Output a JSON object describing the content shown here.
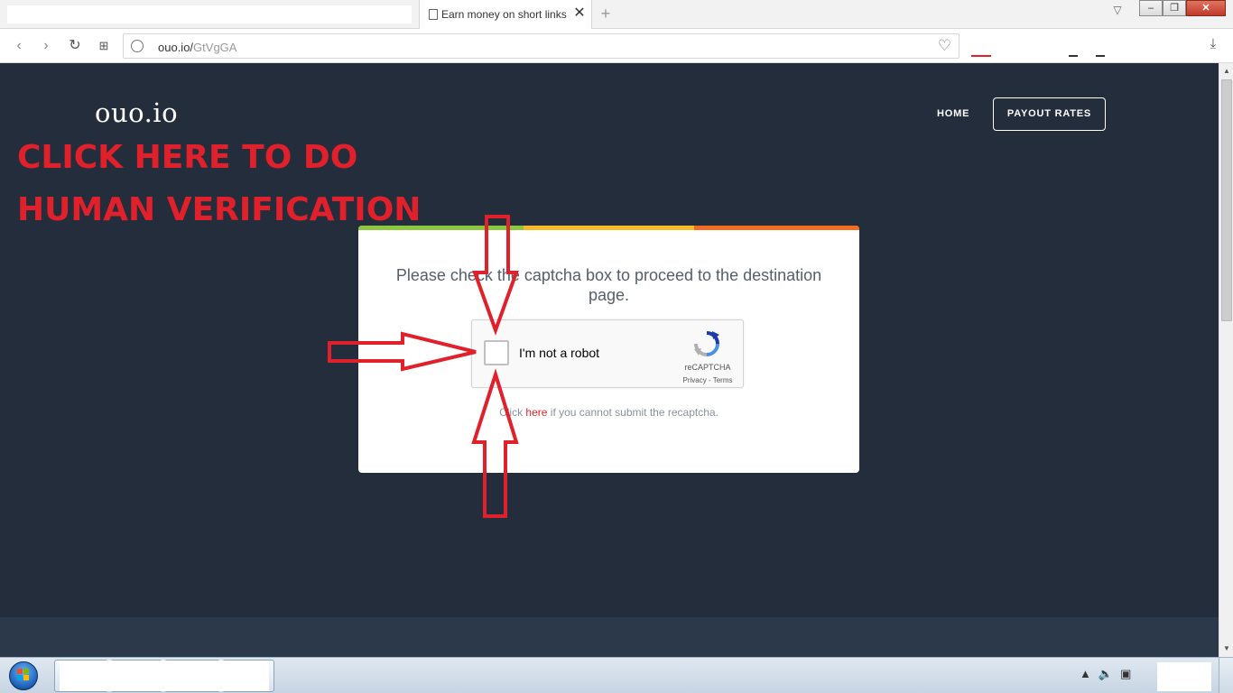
{
  "browser": {
    "tab_title": "Earn money on short links",
    "tab_close": "✕",
    "new_tab": "+",
    "url_host": "ouo.io/",
    "url_path": "GtVgGA"
  },
  "site": {
    "logo": "ouo.io",
    "nav_home": "HOME",
    "nav_payout": "PAYOUT RATES"
  },
  "overlay": {
    "line1": "CLICK HERE TO DO",
    "line2": "HUMAN VERIFICATION"
  },
  "card": {
    "message": "Please check the captcha box to proceed to the destination page.",
    "note_prefix": "Click ",
    "note_link": "here",
    "note_suffix": " if you cannot submit the recaptcha.",
    "stripe_colors": [
      "#8cc63f",
      "#f7b928",
      "#f26b21"
    ]
  },
  "recaptcha": {
    "label": "I'm not a robot",
    "brand": "reCAPTCHA",
    "terms": "Privacy - Terms"
  },
  "colors": {
    "page_bg": "#232d3b",
    "annotation_red": "#e0202a"
  }
}
